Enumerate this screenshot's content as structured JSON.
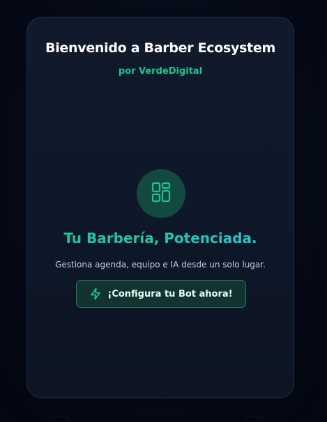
{
  "welcome": {
    "title": "Bienvenido a Barber Ecosystem",
    "subtitle": "por VerdeDigital"
  },
  "hero": {
    "icon": "dashboard-grid-icon",
    "headline": "Tu Barbería, Potenciada.",
    "description": "Gestiona agenda, equipo e IA desde un solo lugar."
  },
  "cta": {
    "label": "¡Configura tu Bot ahora!",
    "icon": "lightning-bolt-icon"
  },
  "colors": {
    "background": "#050915",
    "card": "#0f1829",
    "accent_green": "#1fc48e",
    "accent_cyan": "#28c4d8",
    "icon_circle": "#134a40",
    "button_bg": "#123430",
    "button_border": "#1f7a64"
  }
}
